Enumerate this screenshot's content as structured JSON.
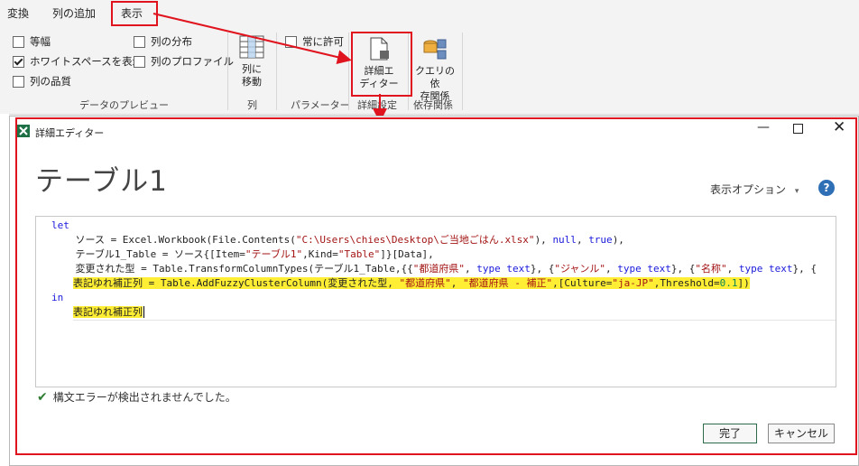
{
  "ribbon": {
    "tabs": [
      "変換",
      "列の追加",
      "表示"
    ],
    "checkboxes": [
      {
        "label": "等幅",
        "checked": false
      },
      {
        "label": "ホワイトスペースを表示",
        "checked": true
      },
      {
        "label": "列の品質",
        "checked": false
      },
      {
        "label": "列の分布",
        "checked": false
      },
      {
        "label": "列のプロファイル",
        "checked": false
      },
      {
        "label": "常に許可",
        "checked": false
      }
    ],
    "group_preview": "データのプレビュー",
    "move_line1": "列に",
    "move_line2": "移動",
    "group_column": "列",
    "group_param": "パラメーター",
    "adv_line1": "詳細エ",
    "adv_line2": "ディター",
    "group_adv": "詳細設定",
    "dep_line1": "クエリの依",
    "dep_line2": "存関係",
    "group_dep": "依存関係"
  },
  "dialog": {
    "title": "詳細エディター",
    "heading": "テーブル1",
    "options": "表示オプション",
    "code": {
      "line1": "let",
      "line2_a": "    ソース = Excel.Workbook(File.Contents(",
      "line2_b": "\"C:\\Users\\chies\\Desktop\\ご当地ごはん.xlsx\"",
      "line2_c": "), ",
      "line2_d": "null",
      "line2_e": ", ",
      "line2_f": "true",
      "line2_g": "),",
      "line3_a": "    テーブル1_Table = ソース{[Item=",
      "line3_b": "\"テーブル1\"",
      "line3_c": ",Kind=",
      "line3_d": "\"Table\"",
      "line3_e": "]}[Data],",
      "line4_a": "    変更された型 = Table.TransformColumnTypes(テーブル1_Table,{{",
      "line4_b": "\"都道府県\"",
      "line4_c": ", ",
      "line4_d": "type text",
      "line4_e": "}, {",
      "line4_f": "\"ジャンル\"",
      "line4_g": ", ",
      "line4_h": "type text",
      "line4_i": "}, {",
      "line4_j": "\"名称\"",
      "line4_k": ", ",
      "line4_l": "type text",
      "line4_m": "}, {",
      "line5_a": "表記ゆれ補正列 = Table.AddFuzzyClusterColumn(変更された型, ",
      "line5_b": "\"都道府県\"",
      "line5_c": ", ",
      "line5_d": "\"都道府県 - 補正\"",
      "line5_e": ",[Culture=",
      "line5_f": "\"ja-JP\"",
      "line5_g": ",Threshold=",
      "line5_h": "0.1",
      "line5_i": "])",
      "line6": "in",
      "line7": "表記ゆれ補正列"
    },
    "status": "構文エラーが検出されませんでした。",
    "done": "完了",
    "cancel": "キャンセル"
  },
  "colors": {
    "highlight": "#e0141e",
    "marker": "#ffee33",
    "check": "#2e7d32"
  }
}
